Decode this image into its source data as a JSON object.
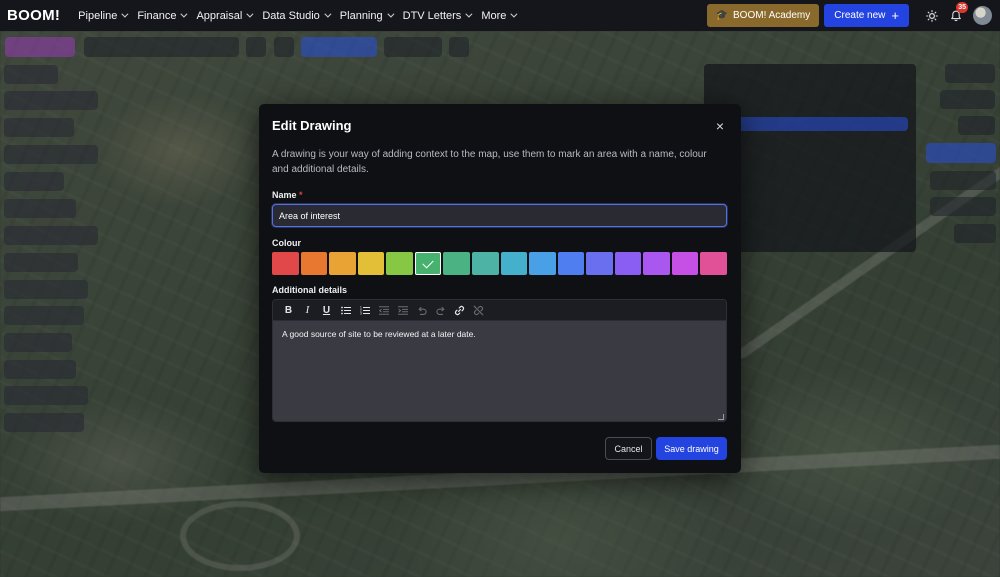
{
  "app": {
    "logo": "BOOM!",
    "nav": [
      {
        "label": "Pipeline"
      },
      {
        "label": "Finance"
      },
      {
        "label": "Appraisal"
      },
      {
        "label": "Data Studio"
      },
      {
        "label": "Planning"
      },
      {
        "label": "DTV Letters"
      },
      {
        "label": "More"
      }
    ],
    "academy_label": "BOOM! Academy",
    "create_label": "Create new",
    "notification_count": "35"
  },
  "modal": {
    "title": "Edit Drawing",
    "description": "A drawing is your way of adding context to the map, use them to mark an area with a name, colour and additional details.",
    "name_label": "Name",
    "required_mark": "*",
    "name_value": "Area of interest",
    "colour_label": "Colour",
    "colours": [
      "#e0484a",
      "#e8782f",
      "#e8a334",
      "#e3be37",
      "#86c844",
      "#46b26d",
      "#4bb383",
      "#4db3a4",
      "#45b0cc",
      "#4aa0e6",
      "#4f7ef0",
      "#6a6ff0",
      "#8a5ef2",
      "#a957ef",
      "#c650e6",
      "#e05197"
    ],
    "selected_colour_index": 5,
    "details_label": "Additional details",
    "toolbar_icons": [
      "bold-icon",
      "italic-icon",
      "underline-icon",
      "bullet-list-icon",
      "numbered-list-icon",
      "outdent-icon",
      "indent-icon",
      "undo-icon",
      "redo-icon",
      "link-icon",
      "unlink-icon"
    ],
    "details_value": "A good source of site to be reviewed at a later date.",
    "cancel_label": "Cancel",
    "save_label": "Save drawing"
  }
}
